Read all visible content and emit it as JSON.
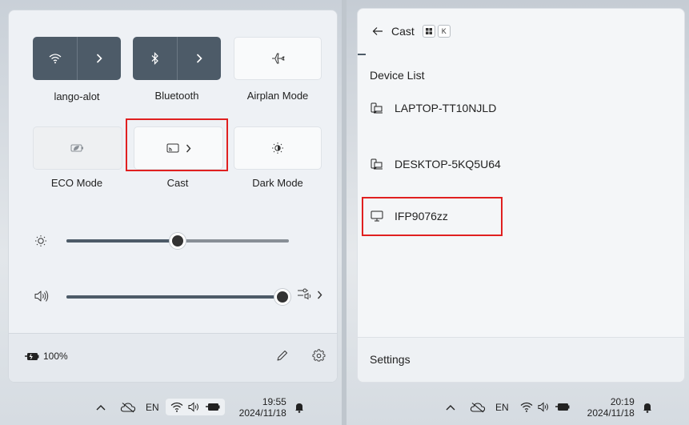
{
  "quick_settings": {
    "wifi_label": "lango-alot",
    "bluetooth_label": "Bluetooth",
    "airplane_label": "Airplan Mode",
    "eco_label": "ECO Mode",
    "cast_label": "Cast",
    "dark_label": "Dark Mode",
    "brightness_percent": 50,
    "volume_percent": 100,
    "battery": "100%"
  },
  "taskbar_left": {
    "lang": "EN",
    "time": "19:55",
    "date": "2024/11/18"
  },
  "cast_panel": {
    "title": "Cast",
    "shortcut_key": "K",
    "section": "Device List",
    "devices": [
      "LAPTOP-TT10NJLD",
      "DESKTOP-5KQ5U64",
      "IFP9076zz"
    ],
    "settings": "Settings"
  },
  "taskbar_right": {
    "lang": "EN",
    "time": "20:19",
    "date": "2024/11/18"
  },
  "colors": {
    "highlight": "#e02020",
    "tile_active": "#4d5b68"
  }
}
